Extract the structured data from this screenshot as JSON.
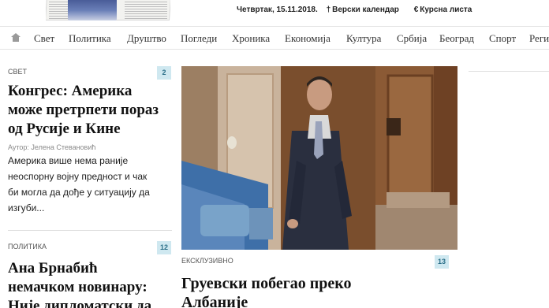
{
  "header": {
    "date": "Четвртак, 15.11.2018.",
    "calendar_icon": "cross-icon",
    "calendar_label": "Верски календар",
    "rates_icon": "euro-icon",
    "rates_label": "Курсна листа"
  },
  "nav": {
    "home_icon": "home-icon",
    "items": [
      "Свет",
      "Политика",
      "Друштво",
      "Погледи",
      "Хроника",
      "Економија",
      "Култура",
      "Србија",
      "Београд",
      "Спорт",
      "Реги"
    ]
  },
  "left": {
    "article1": {
      "category": "СВЕТ",
      "comments": "2",
      "headline_line1": "Конгрес: Америка",
      "headline_line2": "може претрпети пораз",
      "headline_line3": "од Русије и Кине",
      "author": "Аутор: Јелена Стевановић",
      "excerpt_line1": " Америка више нема раније",
      "excerpt_line2": "неоспорну војну предност и чак",
      "excerpt_line3": "би могла да дође у ситуацију да",
      "excerpt_line4": "изгуби..."
    },
    "article2": {
      "category": "ПОЛИТИКА",
      "comments": "12",
      "headline_line1": "Ана Брнабић",
      "headline_line2": "немачком новинару:",
      "headline_line3": "Није дипломатски да"
    }
  },
  "featured": {
    "category": "ЕКСКЛУЗИВНО",
    "comments": "13",
    "headline_line1": "Груевски побегао преко",
    "headline_line2": "Албаније"
  },
  "colors": {
    "badge_bg": "#cfe8f0",
    "badge_text": "#2b6f88"
  }
}
